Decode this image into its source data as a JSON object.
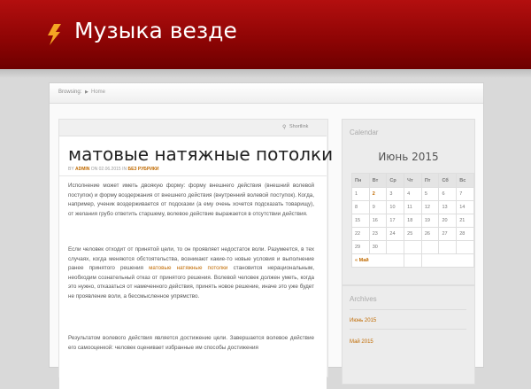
{
  "site": {
    "title": "Музыка везде"
  },
  "breadcrumb": {
    "label": "Browsing:",
    "home": "Home"
  },
  "post": {
    "shortlink": "Shortlink",
    "title": "матовые натяжные потолки",
    "meta": {
      "by": "BY",
      "author": "ADMIN",
      "on": "ON 02.06.2015 IN",
      "category": "БЕЗ РУБРИКИ"
    },
    "paragraphs": [
      "Исполнение может иметь двоякую форму: форму внешнего действия (внешний волевой поступок) и форму воздержания от внешнего действия (внутренний волевой поступок). Когда, например, ученик воздерживается от подсказки (а ему очень хочется подсказать товарищу), от желания грубо ответить старшему, волевое действие выражается в отсутствии действия.",
      "Если человек отходит от принятой цели, то он проявляет недостаток воли. Разумеется, в тех случаях, когда меняются обстоятельства, возникают какие-то новые условия и выполнение ранее принятого решения",
      "матовые натяжные потолки",
      "становится нерациональным, необходим сознательный отказ от принятого решения. Волевой человек должен уметь, когда это нужно, отказаться от намеченного действия, принять новое решение, иначе это уже будет не проявление воли, а бессмысленное упрямство.",
      "Результатом волевого действия является достижение цели. Завершается волевое действие его самооценкой: человек оценивает избранные им способы достижения"
    ]
  },
  "calendar": {
    "title": "Calendar",
    "month": "Июнь 2015",
    "days": [
      "Пн",
      "Вт",
      "Ср",
      "Чт",
      "Пт",
      "Сб",
      "Вс"
    ],
    "weeks": [
      [
        "1",
        "2",
        "3",
        "4",
        "5",
        "6",
        "7"
      ],
      [
        "8",
        "9",
        "10",
        "11",
        "12",
        "13",
        "14"
      ],
      [
        "15",
        "16",
        "17",
        "18",
        "19",
        "20",
        "21"
      ],
      [
        "22",
        "23",
        "24",
        "25",
        "26",
        "27",
        "28"
      ],
      [
        "29",
        "30",
        "",
        "",
        "",
        "",
        ""
      ]
    ],
    "prev": "« Май"
  },
  "archives": {
    "title": "Archives",
    "items": [
      "Июнь 2015",
      "Май 2015"
    ]
  },
  "colors": {
    "header": "#9a0606",
    "accent": "#c06a00"
  }
}
